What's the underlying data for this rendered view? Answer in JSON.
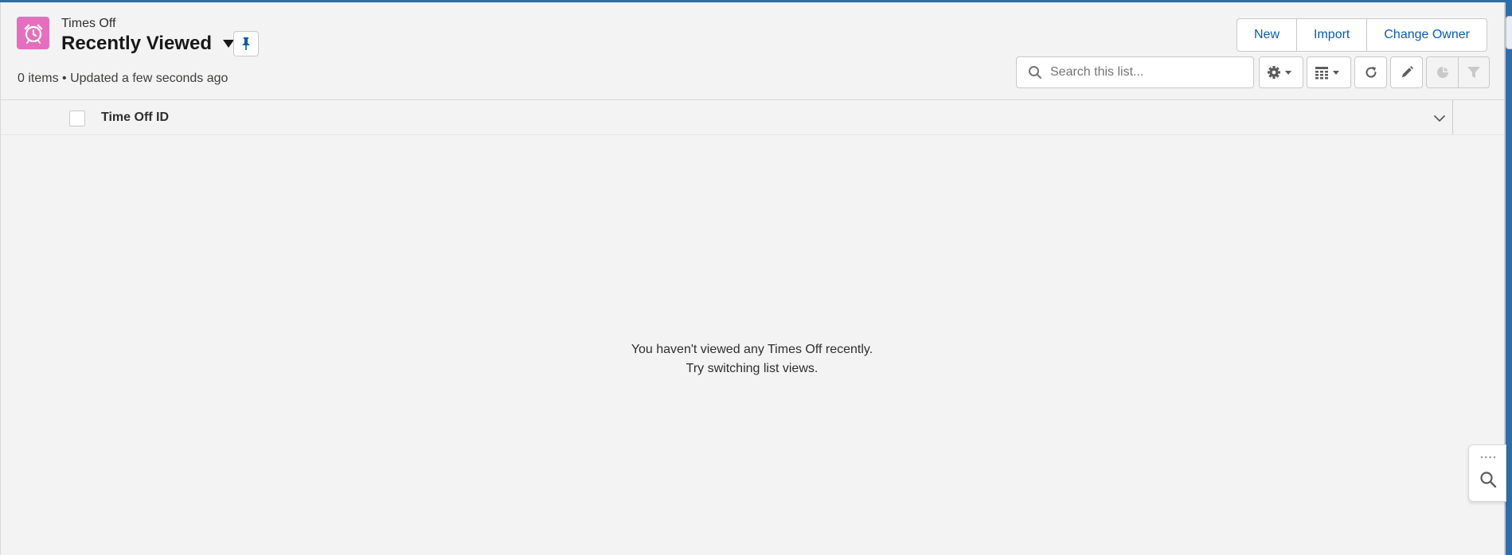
{
  "header": {
    "object_label": "Times Off",
    "view_title": "Recently Viewed",
    "meta": "0 items • Updated a few seconds ago",
    "app_icon": "alarm-clock-icon",
    "icon_color": "#e46fbe"
  },
  "actions": {
    "new_label": "New",
    "import_label": "Import",
    "change_owner_label": "Change Owner"
  },
  "search": {
    "placeholder": "Search this list...",
    "value": ""
  },
  "toolbar": {
    "icons": [
      "gear-icon",
      "table-display-icon",
      "refresh-icon",
      "pencil-icon",
      "chart-icon",
      "filter-icon"
    ]
  },
  "table": {
    "columns": [
      "Time Off ID"
    ],
    "rows": []
  },
  "empty_state": {
    "line1": "You haven't viewed any Times Off recently.",
    "line2": "Try switching list views."
  },
  "colors": {
    "accent": "#0b5cab",
    "brand_strip": "#2e6ea8"
  }
}
